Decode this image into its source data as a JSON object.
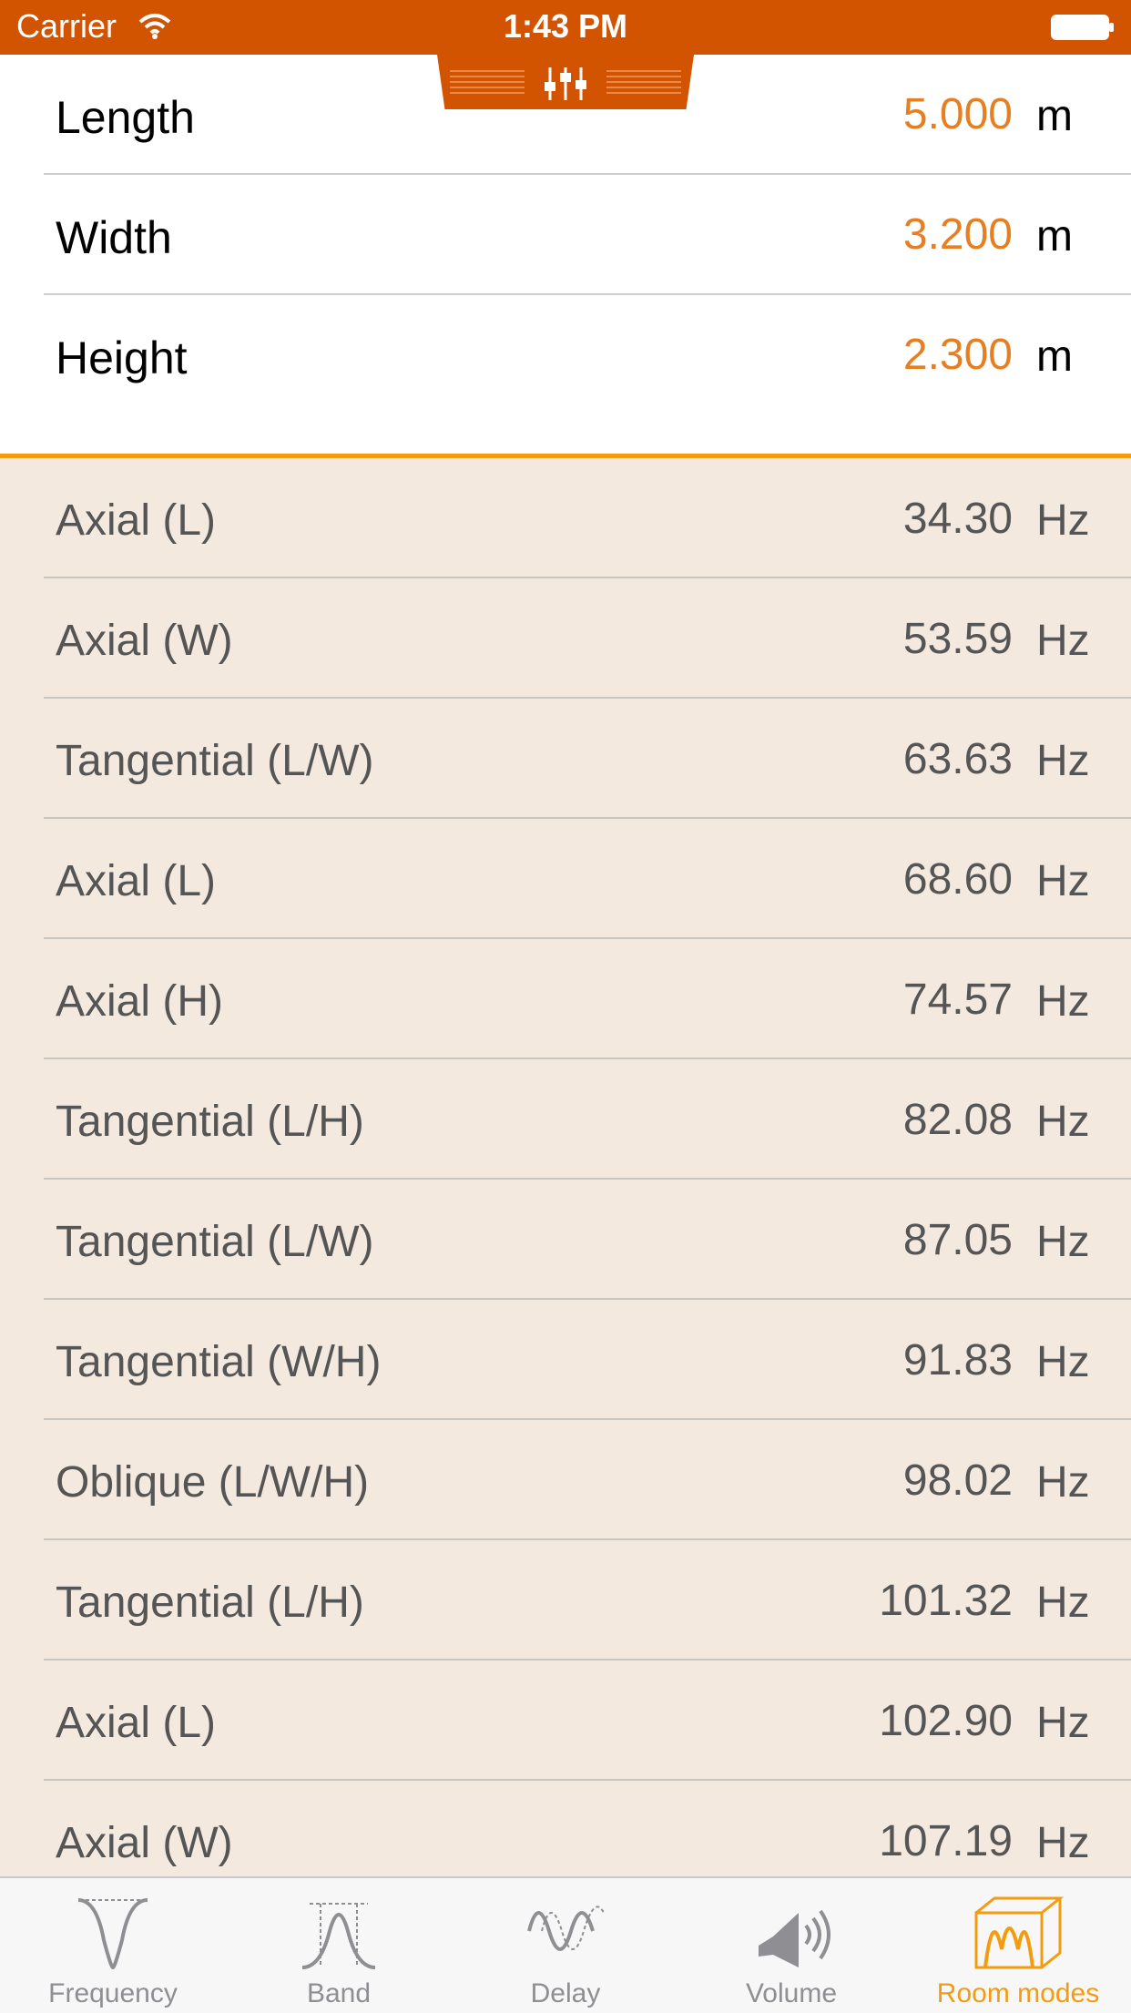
{
  "status_bar": {
    "carrier": "Carrier",
    "time": "1:43 PM"
  },
  "pull_tab": {
    "icon": "sliders-icon"
  },
  "dimensions": [
    {
      "label": "Length",
      "value": "5.000",
      "unit": "m"
    },
    {
      "label": "Width",
      "value": "3.200",
      "unit": "m"
    },
    {
      "label": "Height",
      "value": "2.300",
      "unit": "m"
    }
  ],
  "modes": [
    {
      "label": "Axial (L)",
      "value": "34.30",
      "unit": "Hz"
    },
    {
      "label": "Axial (W)",
      "value": "53.59",
      "unit": "Hz"
    },
    {
      "label": "Tangential (L/W)",
      "value": "63.63",
      "unit": "Hz"
    },
    {
      "label": "Axial (L)",
      "value": "68.60",
      "unit": "Hz"
    },
    {
      "label": "Axial (H)",
      "value": "74.57",
      "unit": "Hz"
    },
    {
      "label": "Tangential (L/H)",
      "value": "82.08",
      "unit": "Hz"
    },
    {
      "label": "Tangential (L/W)",
      "value": "87.05",
      "unit": "Hz"
    },
    {
      "label": "Tangential (W/H)",
      "value": "91.83",
      "unit": "Hz"
    },
    {
      "label": "Oblique (L/W/H)",
      "value": "98.02",
      "unit": "Hz"
    },
    {
      "label": "Tangential (L/H)",
      "value": "101.32",
      "unit": "Hz"
    },
    {
      "label": "Axial (L)",
      "value": "102.90",
      "unit": "Hz"
    },
    {
      "label": "Axial (W)",
      "value": "107.19",
      "unit": "Hz"
    }
  ],
  "tabs": [
    {
      "label": "Frequency",
      "icon": "frequency-icon",
      "active": false
    },
    {
      "label": "Band",
      "icon": "band-icon",
      "active": false
    },
    {
      "label": "Delay",
      "icon": "delay-icon",
      "active": false
    },
    {
      "label": "Volume",
      "icon": "volume-icon",
      "active": false
    },
    {
      "label": "Room modes",
      "icon": "room-modes-icon",
      "active": true
    }
  ],
  "colors": {
    "brand": "#d35400",
    "accent": "#e67e22",
    "active_tab": "#f39c12",
    "results_background": "#f3e9de"
  }
}
